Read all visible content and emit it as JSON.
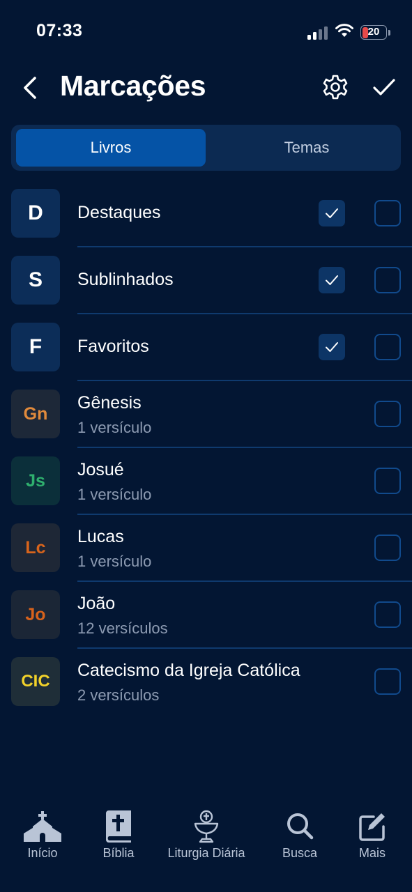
{
  "status_bar": {
    "time": "07:33",
    "battery": "20"
  },
  "header": {
    "title": "Marcações"
  },
  "segments": [
    {
      "label": "Livros",
      "active": true
    },
    {
      "label": "Temas",
      "active": false
    }
  ],
  "rows": [
    {
      "abbr": "D",
      "title": "Destaques",
      "subtitle": "",
      "abbr_color": "#ffffff",
      "icon_bg": "#0c2d58",
      "filled_check": true
    },
    {
      "abbr": "S",
      "title": "Sublinhados",
      "subtitle": "",
      "abbr_color": "#ffffff",
      "icon_bg": "#0c2d58",
      "filled_check": true
    },
    {
      "abbr": "F",
      "title": "Favoritos",
      "subtitle": "",
      "abbr_color": "#ffffff",
      "icon_bg": "#0c2d58",
      "filled_check": true
    },
    {
      "abbr": "Gn",
      "title": "Gênesis",
      "subtitle": "1 versículo",
      "abbr_color": "#e08a3c",
      "icon_bg": "#1d2838",
      "filled_check": false
    },
    {
      "abbr": "Js",
      "title": "Josué",
      "subtitle": "1 versículo",
      "abbr_color": "#2fb06e",
      "icon_bg": "#0b2f3a",
      "filled_check": false
    },
    {
      "abbr": "Lc",
      "title": "Lucas",
      "subtitle": "1 versículo",
      "abbr_color": "#d8641c",
      "icon_bg": "#1e2736",
      "filled_check": false
    },
    {
      "abbr": "Jo",
      "title": "João",
      "subtitle": "12 versículos",
      "abbr_color": "#d6621c",
      "icon_bg": "#1b2636",
      "filled_check": false
    },
    {
      "abbr": "CIC",
      "title": "Catecismo da Igreja Católica",
      "subtitle": "2 versículos",
      "abbr_color": "#f2d22a",
      "icon_bg": "#1f2e38",
      "filled_check": false
    }
  ],
  "tabbar": [
    {
      "label": "Início",
      "icon": "church-icon"
    },
    {
      "label": "Bíblia",
      "icon": "bible-icon"
    },
    {
      "label": "Liturgia Diária",
      "icon": "chalice-icon"
    },
    {
      "label": "Busca",
      "icon": "search-icon"
    },
    {
      "label": "Mais",
      "icon": "edit-icon"
    }
  ],
  "colors": {
    "background": "#031633",
    "accent": "#0553a6",
    "tab_inactive": "#b9c4d6"
  }
}
